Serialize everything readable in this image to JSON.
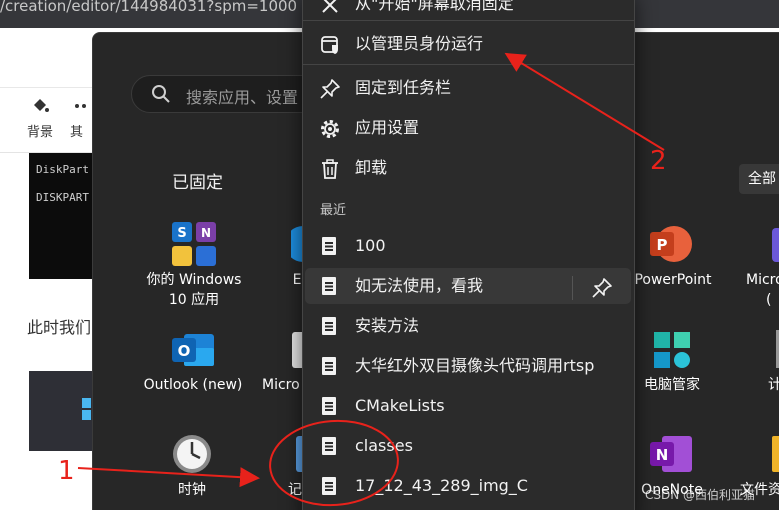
{
  "browser": {
    "url": "/creation/editor/144984031?spm=1000"
  },
  "editor": {
    "toolbar": [
      {
        "label": "背景",
        "icon": "paint-bucket-icon"
      },
      {
        "label": "其",
        "icon": "more-icon"
      }
    ],
    "terminal_lines": [
      "DiskPart",
      "DISKPART"
    ],
    "article_text": "此时我们"
  },
  "start_menu": {
    "search_placeholder": "搜索应用、设置",
    "pinned_title": "已固定",
    "all_button": "全部",
    "apps": [
      {
        "label_line1": "你的 Windows",
        "label_line2": "10 应用",
        "icon": "windows-10-apps-icon"
      },
      {
        "label_line1": "E",
        "icon": "edge-icon"
      },
      {
        "label_line1": "PowerPoint",
        "icon": "powerpoint-icon"
      },
      {
        "label_line1": "Micro",
        "label_line2": "(",
        "icon": "microsoft-app-icon"
      },
      {
        "label_line1": "Outlook (new)",
        "icon": "outlook-icon"
      },
      {
        "label_line1": "Micro",
        "icon": "microsoft-store-icon"
      },
      {
        "label_line1": "电脑管家",
        "icon": "pc-manager-icon"
      },
      {
        "label_line1": "计",
        "icon": "calculator-icon"
      },
      {
        "label_line1": "时钟",
        "icon": "clock-icon"
      },
      {
        "label_line1": "记",
        "icon": "notepad-icon"
      },
      {
        "label_line1": "OneNote",
        "icon": "onenote-icon"
      },
      {
        "label_line1": "文件资",
        "icon": "file-explorer-icon"
      }
    ]
  },
  "context_menu": {
    "top_item": "从\"开始\"屏幕取消固定",
    "actions": [
      {
        "label": "以管理员身份运行",
        "icon": "shield-admin-icon"
      },
      {
        "label": "固定到任务栏",
        "icon": "pin-icon"
      },
      {
        "label": "应用设置",
        "icon": "gear-icon"
      },
      {
        "label": "卸载",
        "icon": "trash-icon"
      }
    ],
    "recent_title": "最近",
    "recent": [
      "100",
      "如无法使用，看我",
      "安装方法",
      "大华红外双目摄像头代码调用rtsp",
      "CMakeLists",
      "classes",
      "17_12_43_289_img_C"
    ]
  },
  "annotations": {
    "num1": "1",
    "num2": "2",
    "color": "#e8221b"
  },
  "watermark": "CSDN @西伯利亚猫"
}
